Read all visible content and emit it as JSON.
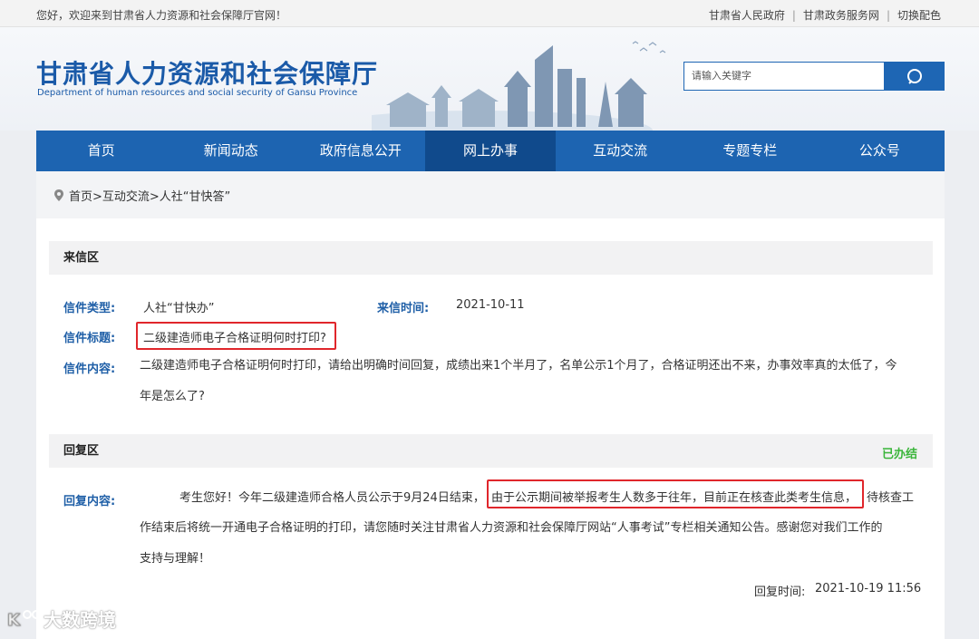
{
  "topbar": {
    "welcome": "您好，欢迎来到甘肃省人力资源和社会保障厅官网！",
    "links": [
      "甘肃省人民政府",
      "甘肃政务服务网",
      "切换配色"
    ]
  },
  "header": {
    "title_cn": "甘肃省人力资源和社会保障厅",
    "title_en": "Department of human resources and social security of Gansu Province",
    "search_placeholder": "请输入关键字",
    "search_icon": "search-icon"
  },
  "nav": {
    "items": [
      "首页",
      "新闻动态",
      "政府信息公开",
      "网上办事",
      "互动交流",
      "专题专栏",
      "公众号"
    ],
    "active": "网上办事"
  },
  "breadcrumb": "首页>互动交流>人社“甘快答”",
  "letter": {
    "section_title": "来信区",
    "type_label": "信件类型:",
    "type_value": "人社“甘快办”",
    "time_label": "来信时间:",
    "time_value": "2021-10-11",
    "subject_label": "信件标题:",
    "subject_value": "二级建造师电子合格证明何时打印?",
    "content_label": "信件内容:",
    "content_line1": "二级建造师电子合格证明何时打印，请给出明确时间回复，成绩出来1个半月了，名单公示1个月了，合格证明还出不来，办事效率真的太低了，今",
    "content_line2": "年是怎么了?"
  },
  "reply": {
    "section_title": "回复区",
    "status": "已办结",
    "content_label": "回复内容:",
    "line1_a": "考生您好！今年二级建造师合格人员公示于9月24日结束，",
    "line1_b": "由于公示期间被举报考生人数多于往年，目前正在核查此类考生信息，",
    "line1_c": "待核查工",
    "line2": "作结束后将统一开通电子合格证明的打印，请您随时关注甘肃省人力资源和社会保障厅网站“人事考试”专栏相关通知公告。感谢您对我们工作的",
    "line3": "支持与理解！",
    "reply_time_label": "回复时间:",
    "reply_time_value": "2021-10-19 11:56"
  },
  "watermark": "大数跨境",
  "colors": {
    "brand_blue": "#1d64b1",
    "nav_active": "#104a8c",
    "label_blue": "#1f5fa7",
    "highlight_red": "#e0262b",
    "done_green": "#3bb53b"
  }
}
